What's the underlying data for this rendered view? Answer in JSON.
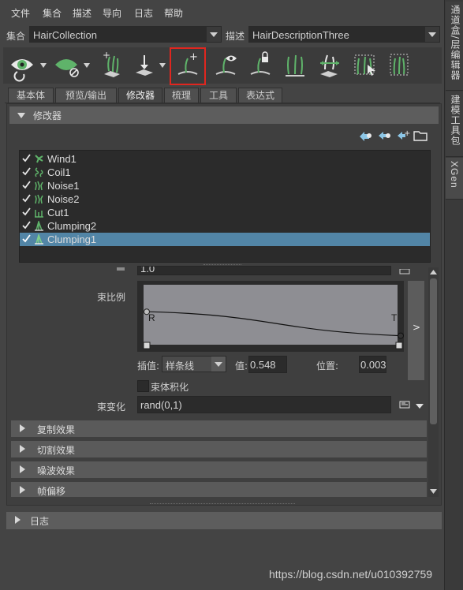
{
  "menu": [
    "文件",
    "集合",
    "描述",
    "导向",
    "日志",
    "帮助"
  ],
  "collection": {
    "label": "集合",
    "value": "HairCollection"
  },
  "description": {
    "label": "描述",
    "value": "HairDescriptionThree"
  },
  "tabs": [
    "基本体",
    "预览/输出",
    "修改器",
    "梳理",
    "工具",
    "表达式"
  ],
  "active_tab": "修改器",
  "modifier_section": {
    "title": "修改器"
  },
  "modifiers": [
    {
      "name": "Wind1",
      "checked": true,
      "icon": "wind-icon",
      "selected": false
    },
    {
      "name": "Coil1",
      "checked": true,
      "icon": "coil-icon",
      "selected": false
    },
    {
      "name": "Noise1",
      "checked": true,
      "icon": "noise-icon",
      "selected": false
    },
    {
      "name": "Noise2",
      "checked": true,
      "icon": "noise-icon",
      "selected": false
    },
    {
      "name": "Cut1",
      "checked": true,
      "icon": "cut-icon",
      "selected": false
    },
    {
      "name": "Clumping2",
      "checked": true,
      "icon": "clumping-icon",
      "selected": false
    },
    {
      "name": "Clumping1",
      "checked": true,
      "icon": "clumping-icon",
      "selected": true
    }
  ],
  "partial_value": "1.0",
  "clump_scale": {
    "label": "束比例",
    "curve_root": "R",
    "curve_tip": "T",
    "expand": ">",
    "interp_label": "插值:",
    "interp_value": "样条线",
    "value_label": "值:",
    "value": "0.548",
    "position_label": "位置:",
    "position": "0.003",
    "curve_points": [
      [
        0.0,
        0.55
      ],
      [
        1.0,
        0.15
      ]
    ]
  },
  "clump_volume": {
    "label": "束体积化",
    "checked": false
  },
  "clump_variance": {
    "label": "束变化",
    "value": "rand(0,1)"
  },
  "collapsed_sections": [
    "复制效果",
    "切割效果",
    "噪波效果",
    "帧偏移"
  ],
  "log_section": {
    "title": "日志"
  },
  "dock_tabs": [
    "通道盒/层编辑器",
    "建模工具包",
    "XGen"
  ],
  "active_dock_tab": "XGen",
  "watermark": "https://blog.csdn.net/u010392759",
  "colors": {
    "highlight": "#e0261f",
    "selection": "#5285a6",
    "accent_green": "#5fb36a"
  }
}
